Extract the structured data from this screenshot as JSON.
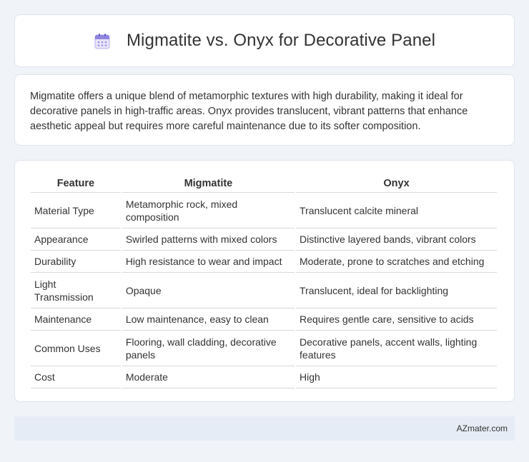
{
  "header": {
    "title": "Migmatite vs. Onyx for Decorative Panel",
    "icon": "calendar-icon",
    "icon_color": "#7b6fd6"
  },
  "intro": {
    "text": "Migmatite offers a unique blend of metamorphic textures with high durability, making it ideal for decorative panels in high-traffic areas. Onyx provides translucent, vibrant patterns that enhance aesthetic appeal but requires more careful maintenance due to its softer composition."
  },
  "table": {
    "headers": [
      "Feature",
      "Migmatite",
      "Onyx"
    ],
    "rows": [
      {
        "feature": "Material Type",
        "migmatite": "Metamorphic rock, mixed composition",
        "onyx": "Translucent calcite mineral"
      },
      {
        "feature": "Appearance",
        "migmatite": "Swirled patterns with mixed colors",
        "onyx": "Distinctive layered bands, vibrant colors"
      },
      {
        "feature": "Durability",
        "migmatite": "High resistance to wear and impact",
        "onyx": "Moderate, prone to scratches and etching"
      },
      {
        "feature": "Light Transmission",
        "migmatite": "Opaque",
        "onyx": "Translucent, ideal for backlighting"
      },
      {
        "feature": "Maintenance",
        "migmatite": "Low maintenance, easy to clean",
        "onyx": "Requires gentle care, sensitive to acids"
      },
      {
        "feature": "Common Uses",
        "migmatite": "Flooring, wall cladding, decorative panels",
        "onyx": "Decorative panels, accent walls, lighting features"
      },
      {
        "feature": "Cost",
        "migmatite": "Moderate",
        "onyx": "High"
      }
    ]
  },
  "footer": {
    "text": "AZmater.com"
  }
}
